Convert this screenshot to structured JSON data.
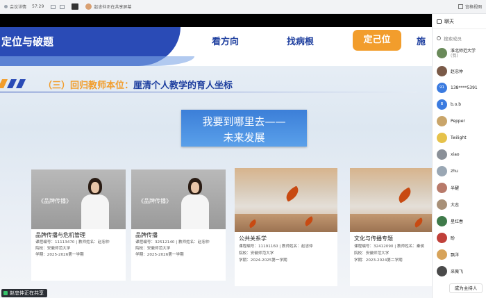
{
  "topbar": {
    "app_label": "会议详情",
    "time": "57:29",
    "signal": "信号",
    "presenter": "赵忠仲正在共享屏幕",
    "layout_label": "宫格视图"
  },
  "slide": {
    "nav_title": "定位与破题",
    "nav_items": [
      "看方向",
      "找病根"
    ],
    "nav_active": "定己位",
    "nav_cut": "施",
    "section_prefix": "（三）回归教师本位：",
    "section_text": "厘清个人教学的育人坐标",
    "banner_line1": "我要到哪里去——",
    "banner_line2": "未来发展",
    "stripe_colors": [
      "#f29d2c",
      "#2a4bb6",
      "#2a4bb6",
      "#f29d2c"
    ],
    "cards": [
      {
        "image_caption": "《品牌传播》",
        "title": "品牌传播与危机管理",
        "code_line": "课程编号：11113470 | 教师姓名：赵忠仲",
        "school_line": "院校：安徽师范大学",
        "term_line": "学期：2025-2026第一学期"
      },
      {
        "image_caption": "《品牌传播》",
        "title": "品牌传播",
        "code_line": "课程编号：32512140 | 教师姓名：赵忠仲",
        "school_line": "院校：安徽师范大学",
        "term_line": "学期：2025-2026第一学期"
      },
      {
        "title": "公共关系学",
        "code_line": "课程编号：11191160 | 教师姓名：赵忠仲",
        "school_line": "院校：安徽师范大学",
        "term_line": "学期：2024-2025第一学期"
      },
      {
        "title": "文化与传播专题",
        "code_line": "课程编号：32412090 | 教师姓名：秦侯",
        "school_line": "院校：安徽师范大学",
        "term_line": "学期：2023-2024第二学期"
      }
    ],
    "sharing_status": "赵忠仲正在共享"
  },
  "panel": {
    "title": "聊天",
    "search_placeholder": "搜索成员",
    "members": [
      {
        "name": "淮北师范大学",
        "sub": "(我)",
        "color": "#6a8a5a"
      },
      {
        "name": "赵忠仲",
        "color": "#7a5a48"
      },
      {
        "name": "138****5391",
        "initial": "91",
        "color": "#3b7be0"
      },
      {
        "name": "b.o.b",
        "initial": "B",
        "color": "#3b7be0"
      },
      {
        "name": "Pepper",
        "color": "#c9a56a"
      },
      {
        "name": "Twilight",
        "color": "#e6c24a"
      },
      {
        "name": "xiao",
        "color": "#8a9098"
      },
      {
        "name": "zhu",
        "color": "#9aa7b4"
      },
      {
        "name": "半醒",
        "color": "#b87a6a"
      },
      {
        "name": "大志",
        "color": "#a89078"
      },
      {
        "name": "星红春",
        "color": "#3f7a4a"
      },
      {
        "name": "盼",
        "color": "#c0403a"
      },
      {
        "name": "飘洋",
        "color": "#d7a35a"
      },
      {
        "name": "采薇飞",
        "color": "#4a4a4a"
      }
    ],
    "host_button": "成为主持人"
  }
}
